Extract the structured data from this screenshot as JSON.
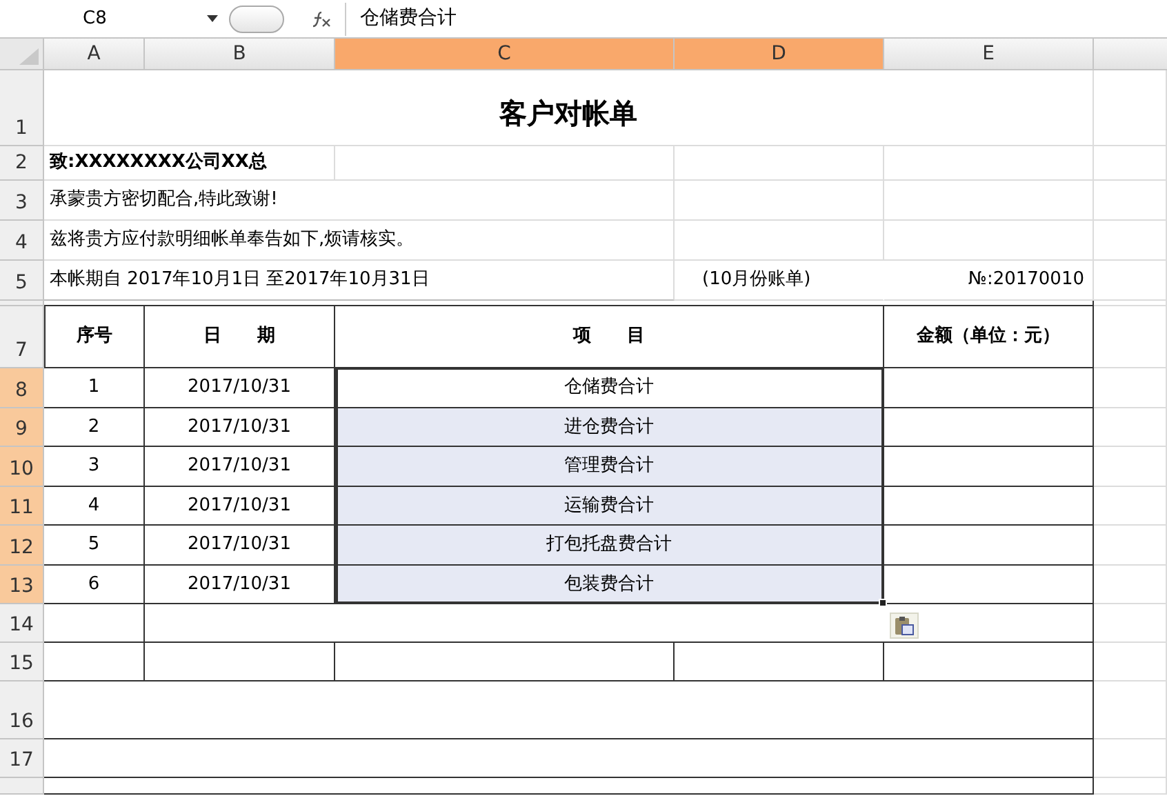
{
  "formula_bar": {
    "name_box": "C8",
    "content": "仓储费合计"
  },
  "column_headers": [
    {
      "label": "A",
      "selected": false
    },
    {
      "label": "B",
      "selected": false
    },
    {
      "label": "C",
      "selected": true
    },
    {
      "label": "D",
      "selected": true
    },
    {
      "label": "E",
      "selected": false
    }
  ],
  "row_headers": [
    {
      "label": "1",
      "selected": false
    },
    {
      "label": "2",
      "selected": false
    },
    {
      "label": "3",
      "selected": false
    },
    {
      "label": "4",
      "selected": false
    },
    {
      "label": "5",
      "selected": false
    },
    {
      "label": "7",
      "selected": false
    },
    {
      "label": "8",
      "selected": true
    },
    {
      "label": "9",
      "selected": true
    },
    {
      "label": "10",
      "selected": true
    },
    {
      "label": "11",
      "selected": true
    },
    {
      "label": "12",
      "selected": true
    },
    {
      "label": "13",
      "selected": true
    },
    {
      "label": "14",
      "selected": false
    },
    {
      "label": "15",
      "selected": false
    },
    {
      "label": "16",
      "selected": false
    },
    {
      "label": "17",
      "selected": false
    }
  ],
  "sheet": {
    "title": "客户对帐单",
    "addressee": "致:XXXXXXXX公司XX总",
    "thanks": "承蒙贵方密切配合,特此致谢!",
    "notice": "兹将贵方应付款明细帐单奉告如下,烦请核实。",
    "period": "本帐期自 2017年10月1日 至2017年10月31日",
    "month_note": "(10月份账单)",
    "number": "№:20170010"
  },
  "table": {
    "columns": [
      "序号",
      "日　　期",
      "项　　目",
      "金额（单位：元）"
    ],
    "items": [
      {
        "seq": "1",
        "date": "2017/10/31",
        "item": "仓储费合计",
        "selected": true,
        "active": true
      },
      {
        "seq": "2",
        "date": "2017/10/31",
        "item": "进仓费合计",
        "selected": true,
        "active": false
      },
      {
        "seq": "3",
        "date": "2017/10/31",
        "item": "管理费合计",
        "selected": true,
        "active": false
      },
      {
        "seq": "4",
        "date": "2017/10/31",
        "item": "运输费合计",
        "selected": true,
        "active": false
      },
      {
        "seq": "5",
        "date": "2017/10/31",
        "item": "打包托盘费合计",
        "selected": true,
        "active": false
      },
      {
        "seq": "6",
        "date": "2017/10/31",
        "item": "包装费合计",
        "selected": true,
        "active": false
      }
    ]
  }
}
